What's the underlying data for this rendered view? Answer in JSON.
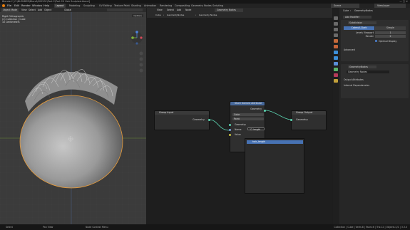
{
  "window": {
    "title": "Blender* [C:\\BLENDER\\Blend\\202201\\Part 2\\Part 20 Hair Sculpted.blend]"
  },
  "menu": {
    "items": [
      "File",
      "Edit",
      "Render",
      "Window",
      "Help"
    ]
  },
  "workspaces": [
    "Layout",
    "Modeling",
    "Sculpting",
    "UV Editing",
    "Texture Paint",
    "Shading",
    "Animation",
    "Rendering",
    "Compositing",
    "Geometry Nodes",
    "Scripting"
  ],
  "scene": {
    "scene_label": "Scene",
    "view_layer": "ViewLayer"
  },
  "viewport": {
    "mode": "Object Mode",
    "header_items": [
      "View",
      "Select",
      "Add",
      "Object"
    ],
    "transform": "Global",
    "options": "Options",
    "overlay_lines": [
      "Right Orthographic",
      "(1) Collection | Cube",
      "10 Centimeters"
    ]
  },
  "node_editor": {
    "header_items": [
      "View",
      "Select",
      "Add",
      "Node"
    ],
    "tree_name": "Geometry Nodes",
    "breadcrumb": [
      "Cube",
      "GeometryNodes",
      "Geometry Nodes"
    ],
    "nodes": {
      "group_input": {
        "title": "Group Input",
        "socket": "Geometry"
      },
      "group_output": {
        "title": "Group Output",
        "socket": "Geometry"
      },
      "store": {
        "title": "Store Named Attribute",
        "geometry_out": "Geometry",
        "type": "Color",
        "domain": "Point",
        "in_geometry": "Geometry",
        "name_label": "Name",
        "name_value": "12 length",
        "value_label": "Value"
      }
    },
    "autocomplete": "hair_length"
  },
  "properties": {
    "header": {
      "object": "Cube",
      "modifier_tree": "GeometryNodes"
    },
    "add_modifier": "Add Modifier",
    "subdivision": {
      "name": "Subdivision",
      "tabs": [
        "Catmull-Clark",
        "Simple"
      ],
      "levels_viewport_label": "Levels Viewport",
      "levels_viewport_value": "1",
      "render_label": "Render",
      "render_value": "2",
      "optimal_display": "Optimal Display",
      "advanced": "Advanced"
    },
    "geometry_nodes": {
      "name": "GeometryNodes",
      "tree": "Geometry Nodes",
      "output_attributes": "Output Attributes",
      "internal_dependencies": "Internal Dependencies"
    }
  },
  "statusbar": {
    "left": [
      "Select",
      "Pan View",
      "Node Context Menu"
    ],
    "right": "Collection | Cube | Verts:8 | Faces:6 | Tris:12 | Objects:1/1 | 3.3.0"
  }
}
